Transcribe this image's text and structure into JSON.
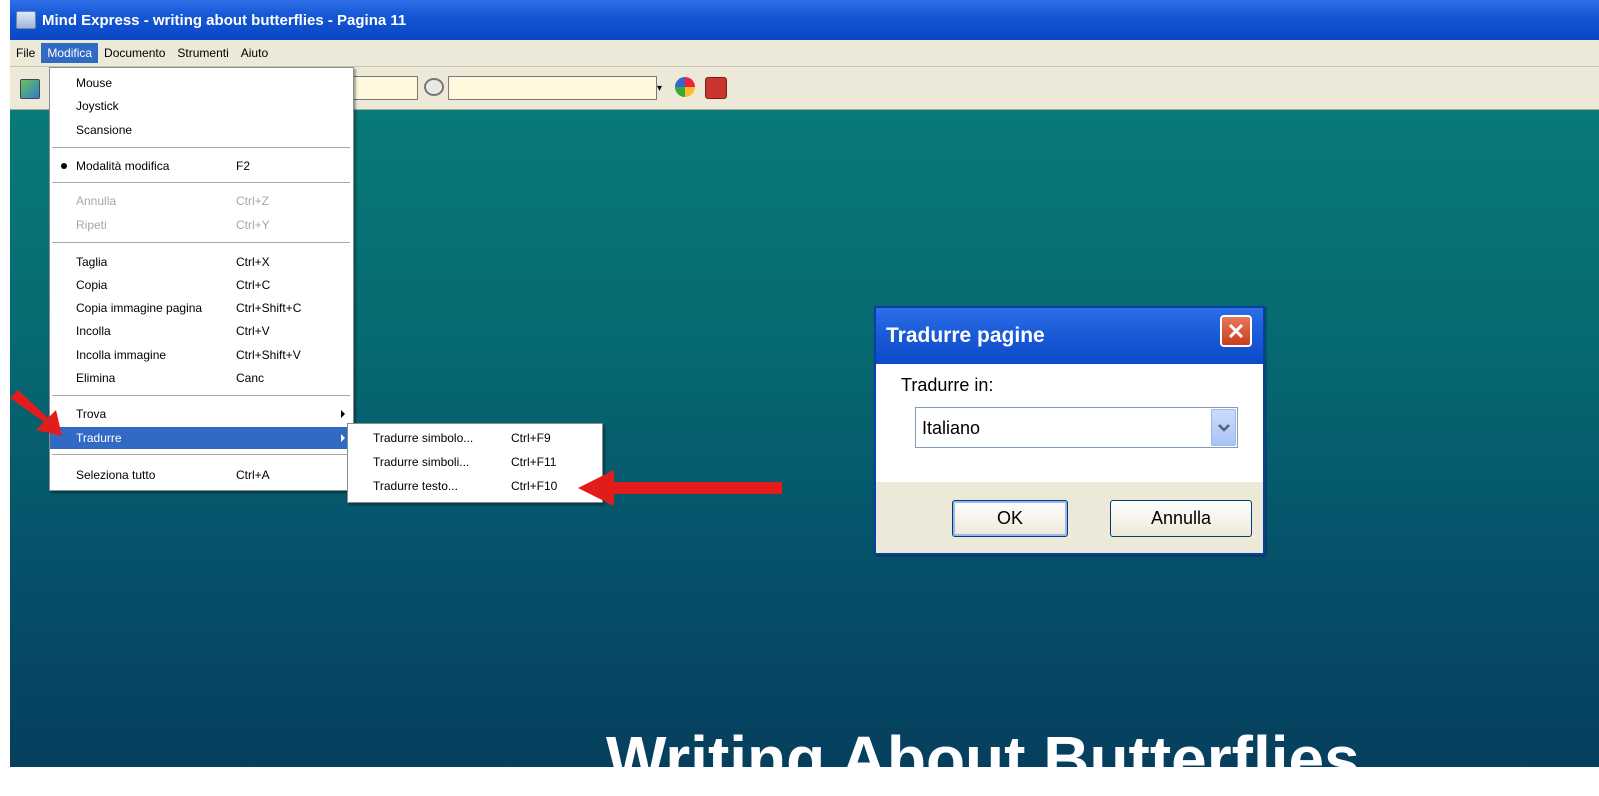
{
  "window": {
    "title": "Mind Express - writing about butterflies - Pagina 11"
  },
  "menubar": {
    "items": [
      "File",
      "Modifica",
      "Documento",
      "Strumenti",
      "Aiuto"
    ],
    "active": "Modifica"
  },
  "edit_menu": {
    "items": [
      {
        "label": "Mouse",
        "shortcut": ""
      },
      {
        "label": "Joystick",
        "shortcut": ""
      },
      {
        "label": "Scansione",
        "shortcut": ""
      },
      {
        "label": "Modalità modifica",
        "shortcut": "F2",
        "checked": true
      },
      {
        "label": "Annulla",
        "shortcut": "Ctrl+Z",
        "disabled": true
      },
      {
        "label": "Ripeti",
        "shortcut": "Ctrl+Y",
        "disabled": true
      },
      {
        "label": "Taglia",
        "shortcut": "Ctrl+X"
      },
      {
        "label": "Copia",
        "shortcut": "Ctrl+C"
      },
      {
        "label": "Copia immagine pagina",
        "shortcut": "Ctrl+Shift+C"
      },
      {
        "label": "Incolla",
        "shortcut": "Ctrl+V"
      },
      {
        "label": "Incolla immagine",
        "shortcut": "Ctrl+Shift+V"
      },
      {
        "label": "Elimina",
        "shortcut": "Canc"
      },
      {
        "label": "Trova",
        "shortcut": "",
        "submenu": true
      },
      {
        "label": "Tradurre",
        "shortcut": "",
        "submenu": true,
        "selected": true
      },
      {
        "label": "Seleziona tutto",
        "shortcut": "Ctrl+A"
      }
    ]
  },
  "translate_submenu": {
    "items": [
      {
        "label": "Tradurre simbolo...",
        "shortcut": "Ctrl+F9"
      },
      {
        "label": "Tradurre simboli...",
        "shortcut": "Ctrl+F11"
      },
      {
        "label": "Tradurre testo...",
        "shortcut": "Ctrl+F10"
      }
    ]
  },
  "dialog": {
    "title": "Tradurre pagine",
    "prompt": "Tradurre in:",
    "selected_language": "Italiano",
    "ok_label": "OK",
    "cancel_label": "Annulla"
  },
  "page": {
    "heading": "Writing About Butterflies"
  },
  "colors": {
    "menu_highlight": "#316ac5",
    "arrow_red": "#e21b1b",
    "workspace_top": "#087a78",
    "workspace_bottom": "#063f5e"
  },
  "icons": [
    "app-icon",
    "page-icon",
    "speech-balloon-icon",
    "paint-palette-icon",
    "book-icon",
    "close-icon",
    "chevron-down-icon",
    "submenu-arrow-icon"
  ]
}
